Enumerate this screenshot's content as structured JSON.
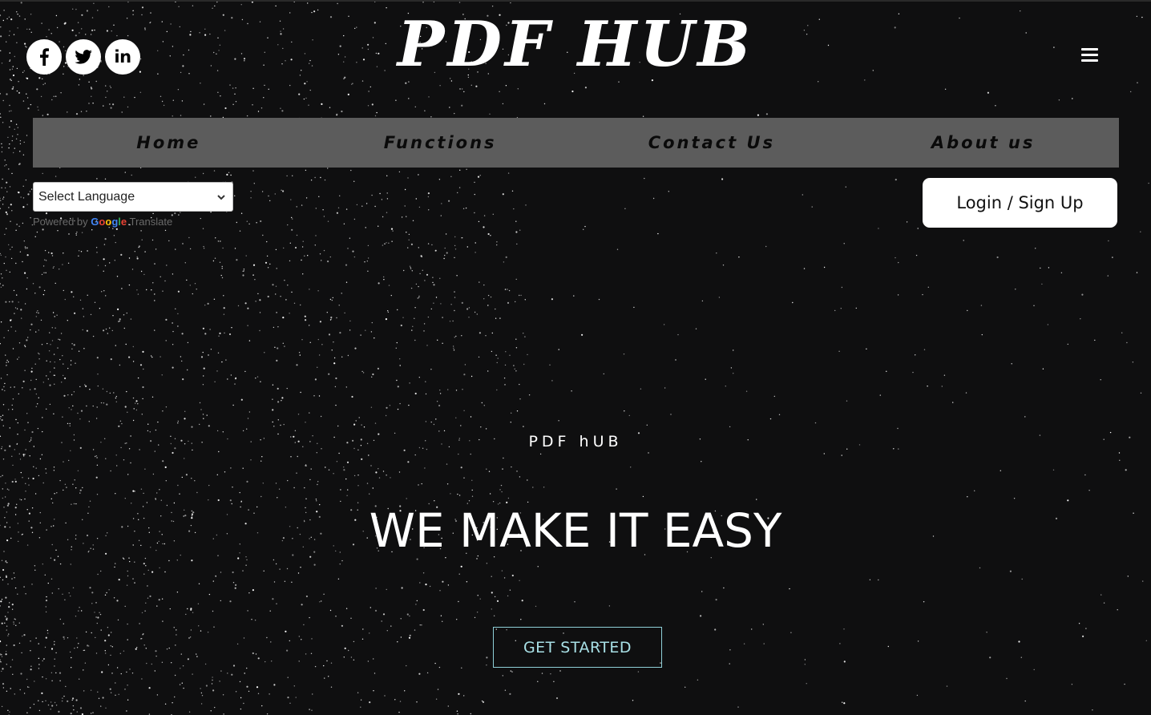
{
  "social": [
    {
      "icon": "facebook-icon",
      "label": "f"
    },
    {
      "icon": "twitter-icon",
      "label": ""
    },
    {
      "icon": "linkedin-icon",
      "label": "in"
    }
  ],
  "logo": "PDF HUB",
  "nav": [
    "Home",
    "Functions",
    "Contact Us",
    "About us"
  ],
  "language": {
    "selected": "Select Language",
    "powered_prefix": "Powered by",
    "google": "Google",
    "translate": "Translate"
  },
  "login_label": "Login / Sign Up",
  "hero": {
    "subtitle": "PDF hUB",
    "headline": "WE MAKE IT EASY",
    "cta": "GET STARTED"
  },
  "colors": {
    "background": "#0f0f10",
    "navbar": "#5c5c5c",
    "cta_border": "#8fd0d8",
    "cta_text": "#a8e0e6",
    "google_blue": "#4285F4",
    "google_red": "#EA4335",
    "google_yellow": "#FBBC05",
    "google_green": "#34A853"
  }
}
